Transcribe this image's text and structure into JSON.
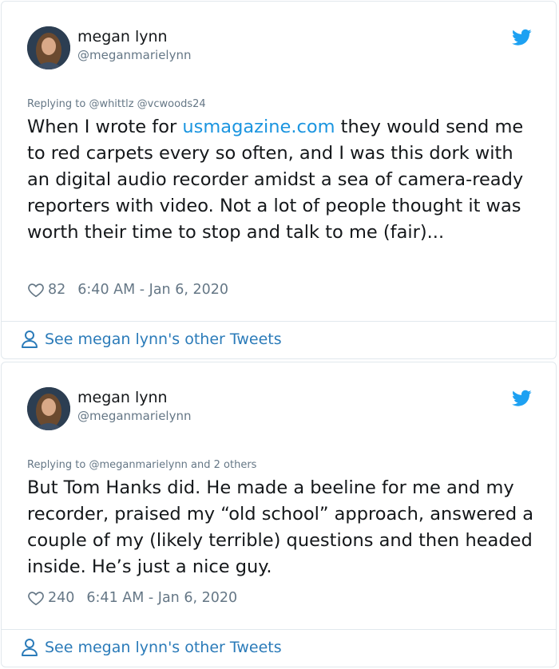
{
  "colors": {
    "link": "#1b95e0",
    "secondary_text": "#657786",
    "primary_text": "#14171a",
    "twitter_blue": "#1da1f2",
    "see_more": "#2b7bb9"
  },
  "tweets": [
    {
      "author_name": "megan lynn",
      "author_handle": "@meganmarielynn",
      "reply_prefix": "Replying to",
      "reply_to": "@whittlz @vcwoods24",
      "text_before_link": "When I wrote for ",
      "link_text": "usmagazine.com",
      "text_after_link": " they would send me to red carpets every so often, and I was this dork with an digital audio recorder amidst a sea of camera-ready reporters with video. Not a lot of people thought it was worth their time to stop and talk to me (fair)...",
      "likes": "82",
      "timestamp": "6:40 AM - Jan 6, 2020",
      "see_more": "See megan lynn's other Tweets",
      "icons": {
        "heart": "heart-icon",
        "bird": "twitter-bird-icon",
        "person": "person-icon"
      }
    },
    {
      "author_name": "megan lynn",
      "author_handle": "@meganmarielynn",
      "reply_prefix": "Replying to",
      "reply_to": "@meganmarielynn and 2 others",
      "text": "But Tom Hanks did. He made a beeline for me and my recorder,  praised my “old school” approach, answered a couple of my (likely terrible) questions and then headed inside. He’s just a nice guy.",
      "likes": "240",
      "timestamp": "6:41 AM - Jan 6, 2020",
      "see_more": "See megan lynn's other Tweets",
      "icons": {
        "heart": "heart-icon",
        "bird": "twitter-bird-icon",
        "person": "person-icon"
      }
    }
  ]
}
